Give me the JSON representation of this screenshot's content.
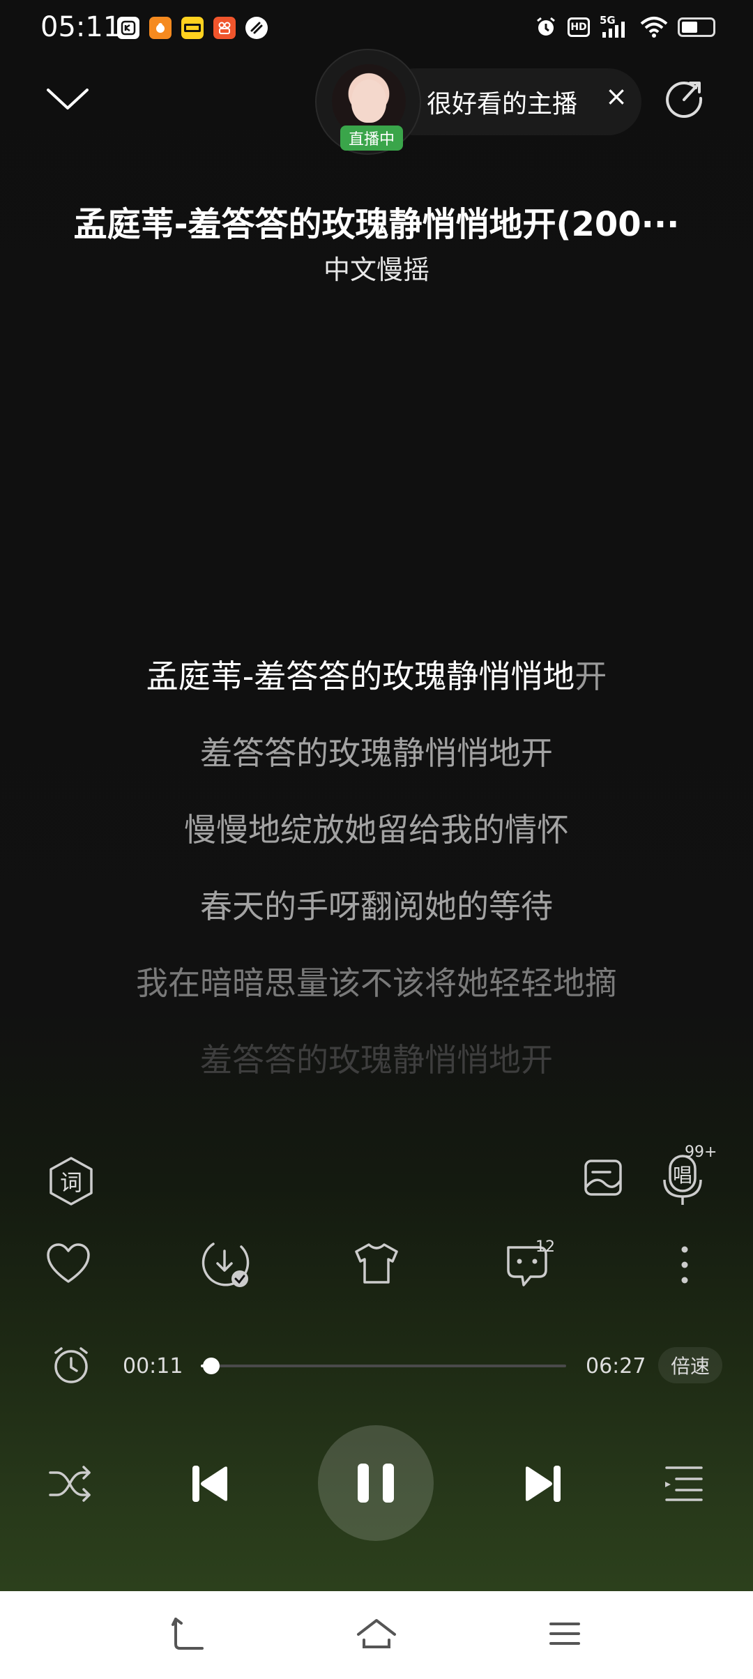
{
  "status_bar": {
    "time": "05:11",
    "notification_icons": [
      "app-icon-1",
      "app-icon-2",
      "kuaikan-icon",
      "app-icon-4",
      "app-icon-5"
    ],
    "network": "5G",
    "hd_label": "HD"
  },
  "header": {
    "live": {
      "badge": "直播中",
      "text": "很好看的主播",
      "close": "×"
    }
  },
  "song": {
    "title": "孟庭苇-羞答答的玫瑰静悄悄地开(200···",
    "subtitle": "中文慢摇"
  },
  "lyrics": {
    "active_sung": "孟庭苇-羞答答的玫瑰静悄悄地",
    "active_rest": "开",
    "lines": [
      "羞答答的玫瑰静悄悄地开",
      "慢慢地绽放她留给我的情怀",
      "春天的手呀翻阅她的等待",
      "我在暗暗思量该不该将她轻轻地摘",
      "羞答答的玫瑰静悄悄地开"
    ]
  },
  "toolbar": {
    "lyrics_label": "词",
    "sing_label": "唱",
    "sing_count": "99+",
    "comment_count": "12"
  },
  "progress": {
    "current": "00:11",
    "total": "06:27",
    "fraction": 0.028,
    "speed_label": "倍速"
  },
  "colors": {
    "background": "#121212",
    "live_badge": "#3aa54a",
    "gradient_bottom": "#2c401c",
    "nav_bar": "#ffffff"
  }
}
